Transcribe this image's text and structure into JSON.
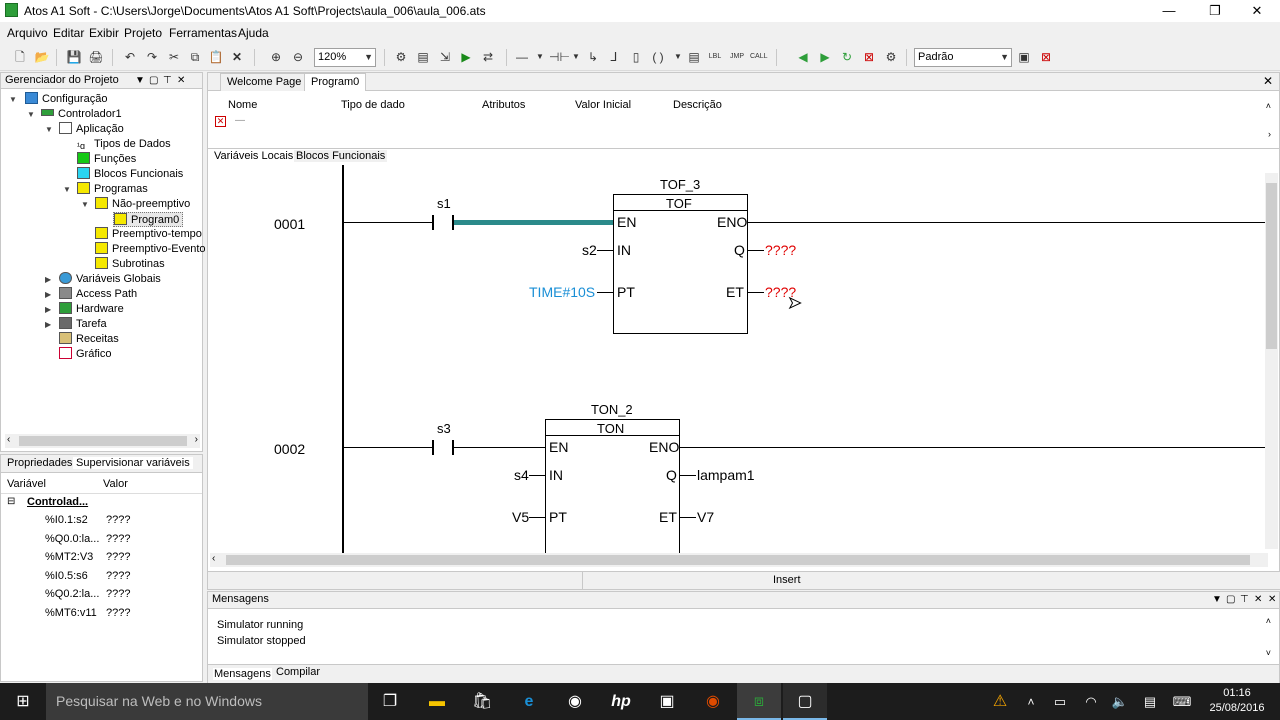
{
  "window": {
    "title": "Atos A1 Soft - C:\\Users\\Jorge\\Documents\\Atos A1 Soft\\Projects\\aula_006\\aula_006.ats",
    "minimize": "—",
    "restore": "❐",
    "close": "✕"
  },
  "menu": [
    "Arquivo",
    "Editar",
    "Exibir",
    "Projeto",
    "Ferramentas",
    "Ajuda"
  ],
  "toolbar": {
    "zoom": "120%",
    "profile": "Padrão"
  },
  "project_pane": {
    "title": "Gerenciador do Projeto",
    "tree": [
      "Configuração",
      "Controlador1",
      "Aplicação",
      "Tipos de Dados",
      "Funções",
      "Blocos Funcionais",
      "Programas",
      "Não-preemptivo",
      "Program0",
      "Preemptivo-tempo",
      "Preemptivo-Evento",
      "Subrotinas",
      "Variáveis Globais",
      "Access Path",
      "Hardware",
      "Tarefa",
      "Receitas",
      "Gráfico"
    ]
  },
  "props_pane": {
    "tabs": [
      "Propriedades",
      "Supervisionar variáveis"
    ],
    "headers": [
      "Variável",
      "Valor"
    ],
    "group": "Controlad...",
    "rows": [
      {
        "var": "%I0.1:s2",
        "val": "????"
      },
      {
        "var": "%Q0.0:la...",
        "val": "????"
      },
      {
        "var": "%MT2:V3",
        "val": "????"
      },
      {
        "var": "%I0.5:s6",
        "val": "????"
      },
      {
        "var": "%Q0.2:la...",
        "val": "????"
      },
      {
        "var": "%MT6:v11",
        "val": "????"
      }
    ]
  },
  "doc": {
    "tabs": [
      "Welcome Page",
      "Program0"
    ],
    "columns": [
      "Nome",
      "Tipo de dado",
      "Atributos",
      "Valor Inicial",
      "Descrição"
    ],
    "subtabs": [
      "Variáveis Locais",
      "Blocos Funcionais"
    ],
    "status_mode": "Insert",
    "rungs": [
      {
        "number": "0001",
        "contact": "s1",
        "instance": "TOF_3",
        "type": "TOF",
        "inputs": [
          "EN",
          "IN",
          "PT"
        ],
        "outputs": [
          "ENO",
          "Q",
          "ET"
        ],
        "in_vars": [
          "s2",
          "TIME#10S"
        ],
        "out_vars": [
          "????",
          "????"
        ]
      },
      {
        "number": "0002",
        "contact": "s3",
        "instance": "TON_2",
        "type": "TON",
        "inputs": [
          "EN",
          "IN",
          "PT"
        ],
        "outputs": [
          "ENO",
          "Q",
          "ET"
        ],
        "in_vars": [
          "s4",
          "V5"
        ],
        "out_vars": [
          "lampam1",
          "V7"
        ]
      }
    ]
  },
  "messages": {
    "title": "Mensagens",
    "lines": [
      "Simulator running",
      "Simulator stopped"
    ],
    "tabs": [
      "Mensagens",
      "Compilar"
    ]
  },
  "taskbar": {
    "search": "Pesquisar na Web e no Windows",
    "time": "01:16",
    "date": "25/08/2016"
  },
  "colors": {
    "active_wire": "#2b8a8a",
    "unknown_value": "#e00000",
    "time_literal": "#1a8fd6"
  }
}
